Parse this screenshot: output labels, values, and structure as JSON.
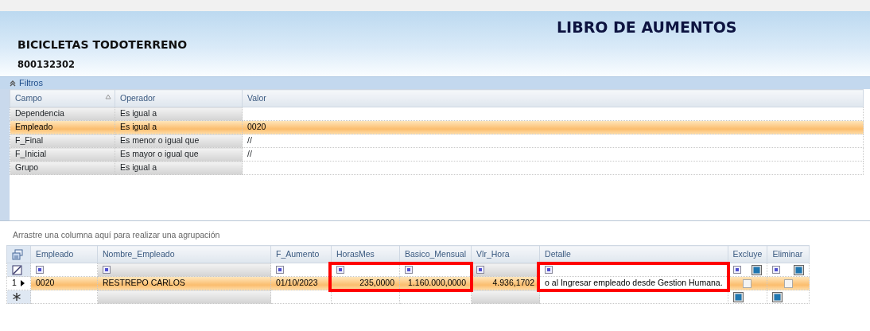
{
  "header": {
    "company": "BICICLETAS TODOTERRENO",
    "nit": "800132302",
    "title": "LIBRO DE AUMENTOS"
  },
  "filters": {
    "label": "Filtros",
    "expanded": true,
    "columns": [
      {
        "label": "Campo",
        "sorted": true
      },
      {
        "label": "Operador",
        "sorted": false
      },
      {
        "label": "Valor",
        "sorted": false
      }
    ],
    "rows": [
      {
        "campo": "Dependencia",
        "operador": "Es igual a",
        "valor": "",
        "selected": false
      },
      {
        "campo": "Empleado",
        "operador": "Es igual a",
        "valor": "0020",
        "selected": true
      },
      {
        "campo": "F_Final",
        "operador": "Es menor o igual que",
        "valor": "//",
        "selected": false
      },
      {
        "campo": "F_Inicial",
        "operador": "Es mayor o igual que",
        "valor": "//",
        "selected": false
      },
      {
        "campo": "Grupo",
        "operador": "Es igual a",
        "valor": "",
        "selected": false
      }
    ]
  },
  "group_hint": "Arrastre una columna aquí para realizar una agrupación",
  "grid": {
    "columns": [
      {
        "label": "Empleado",
        "kind": "text",
        "readonly": false,
        "highlighted": false
      },
      {
        "label": "Nombre_Empleado",
        "kind": "text",
        "readonly": true,
        "highlighted": false
      },
      {
        "label": "F_Aumento",
        "kind": "text",
        "readonly": false,
        "highlighted": false
      },
      {
        "label": "HorasMes",
        "kind": "number",
        "readonly": false,
        "highlighted": true
      },
      {
        "label": "Basico_Mensual",
        "kind": "number",
        "readonly": false,
        "highlighted": true
      },
      {
        "label": "Vlr_Hora",
        "kind": "number",
        "readonly": true,
        "highlighted": false
      },
      {
        "label": "Detalle",
        "kind": "editing",
        "readonly": false,
        "highlighted": true
      },
      {
        "label": "Excluye",
        "kind": "check",
        "readonly": false,
        "highlighted": false
      },
      {
        "label": "Eliminar",
        "kind": "check",
        "readonly": false,
        "highlighted": false
      }
    ],
    "rows": [
      {
        "row_number": "1",
        "selected": true,
        "cells": [
          "0020",
          "RESTREPO  CARLOS",
          "01/10/2023",
          "235,0000",
          "1.160.000,0000",
          "4.936,1702",
          "o al Ingresar empleado desde Gestion Humana.",
          false,
          false
        ]
      }
    ]
  }
}
